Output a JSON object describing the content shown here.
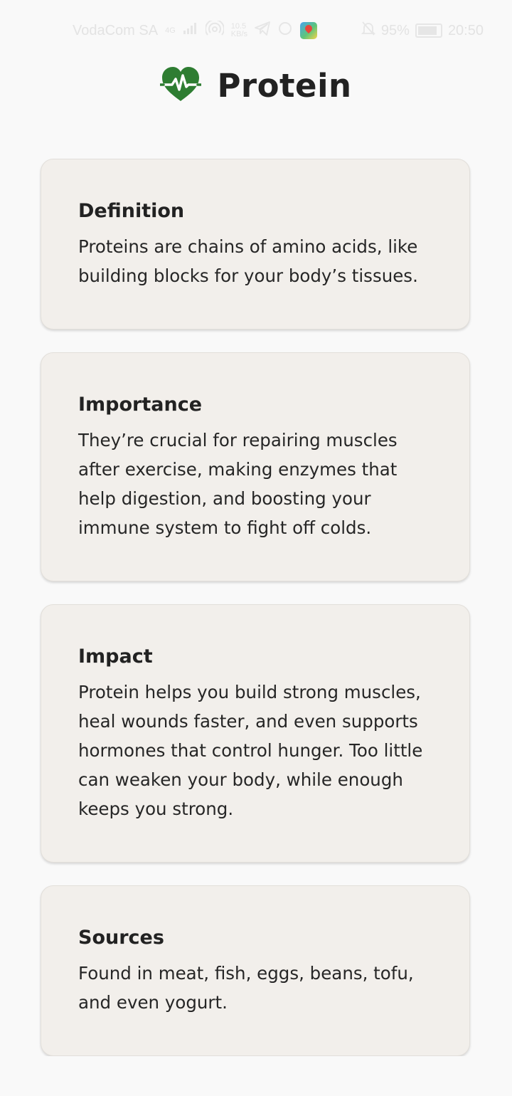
{
  "status_bar": {
    "carrier": "VodaCom SA",
    "network_type": "4G",
    "data_speed": "10.5",
    "data_speed_unit": "KB/s",
    "battery_percent": "95%",
    "time": "20:50"
  },
  "header": {
    "icon": "heart-pulse-icon",
    "title": "Protein",
    "icon_color": "#2e7d32"
  },
  "cards": [
    {
      "title": "Definition",
      "body": "Proteins are chains of amino acids, like building blocks for your body’s tissues."
    },
    {
      "title": "Importance",
      "body": "They’re crucial for repairing muscles after exercise, making enzymes that help digestion, and boosting your immune system to fight off colds."
    },
    {
      "title": "Impact",
      "body": "Protein helps you build strong muscles, heal wounds faster, and even supports hormones that control hunger. Too little can weaken your body, while enough keeps you strong."
    },
    {
      "title": "Sources",
      "body": "Found in meat, fish, eggs, beans, tofu, and even yogurt."
    }
  ]
}
